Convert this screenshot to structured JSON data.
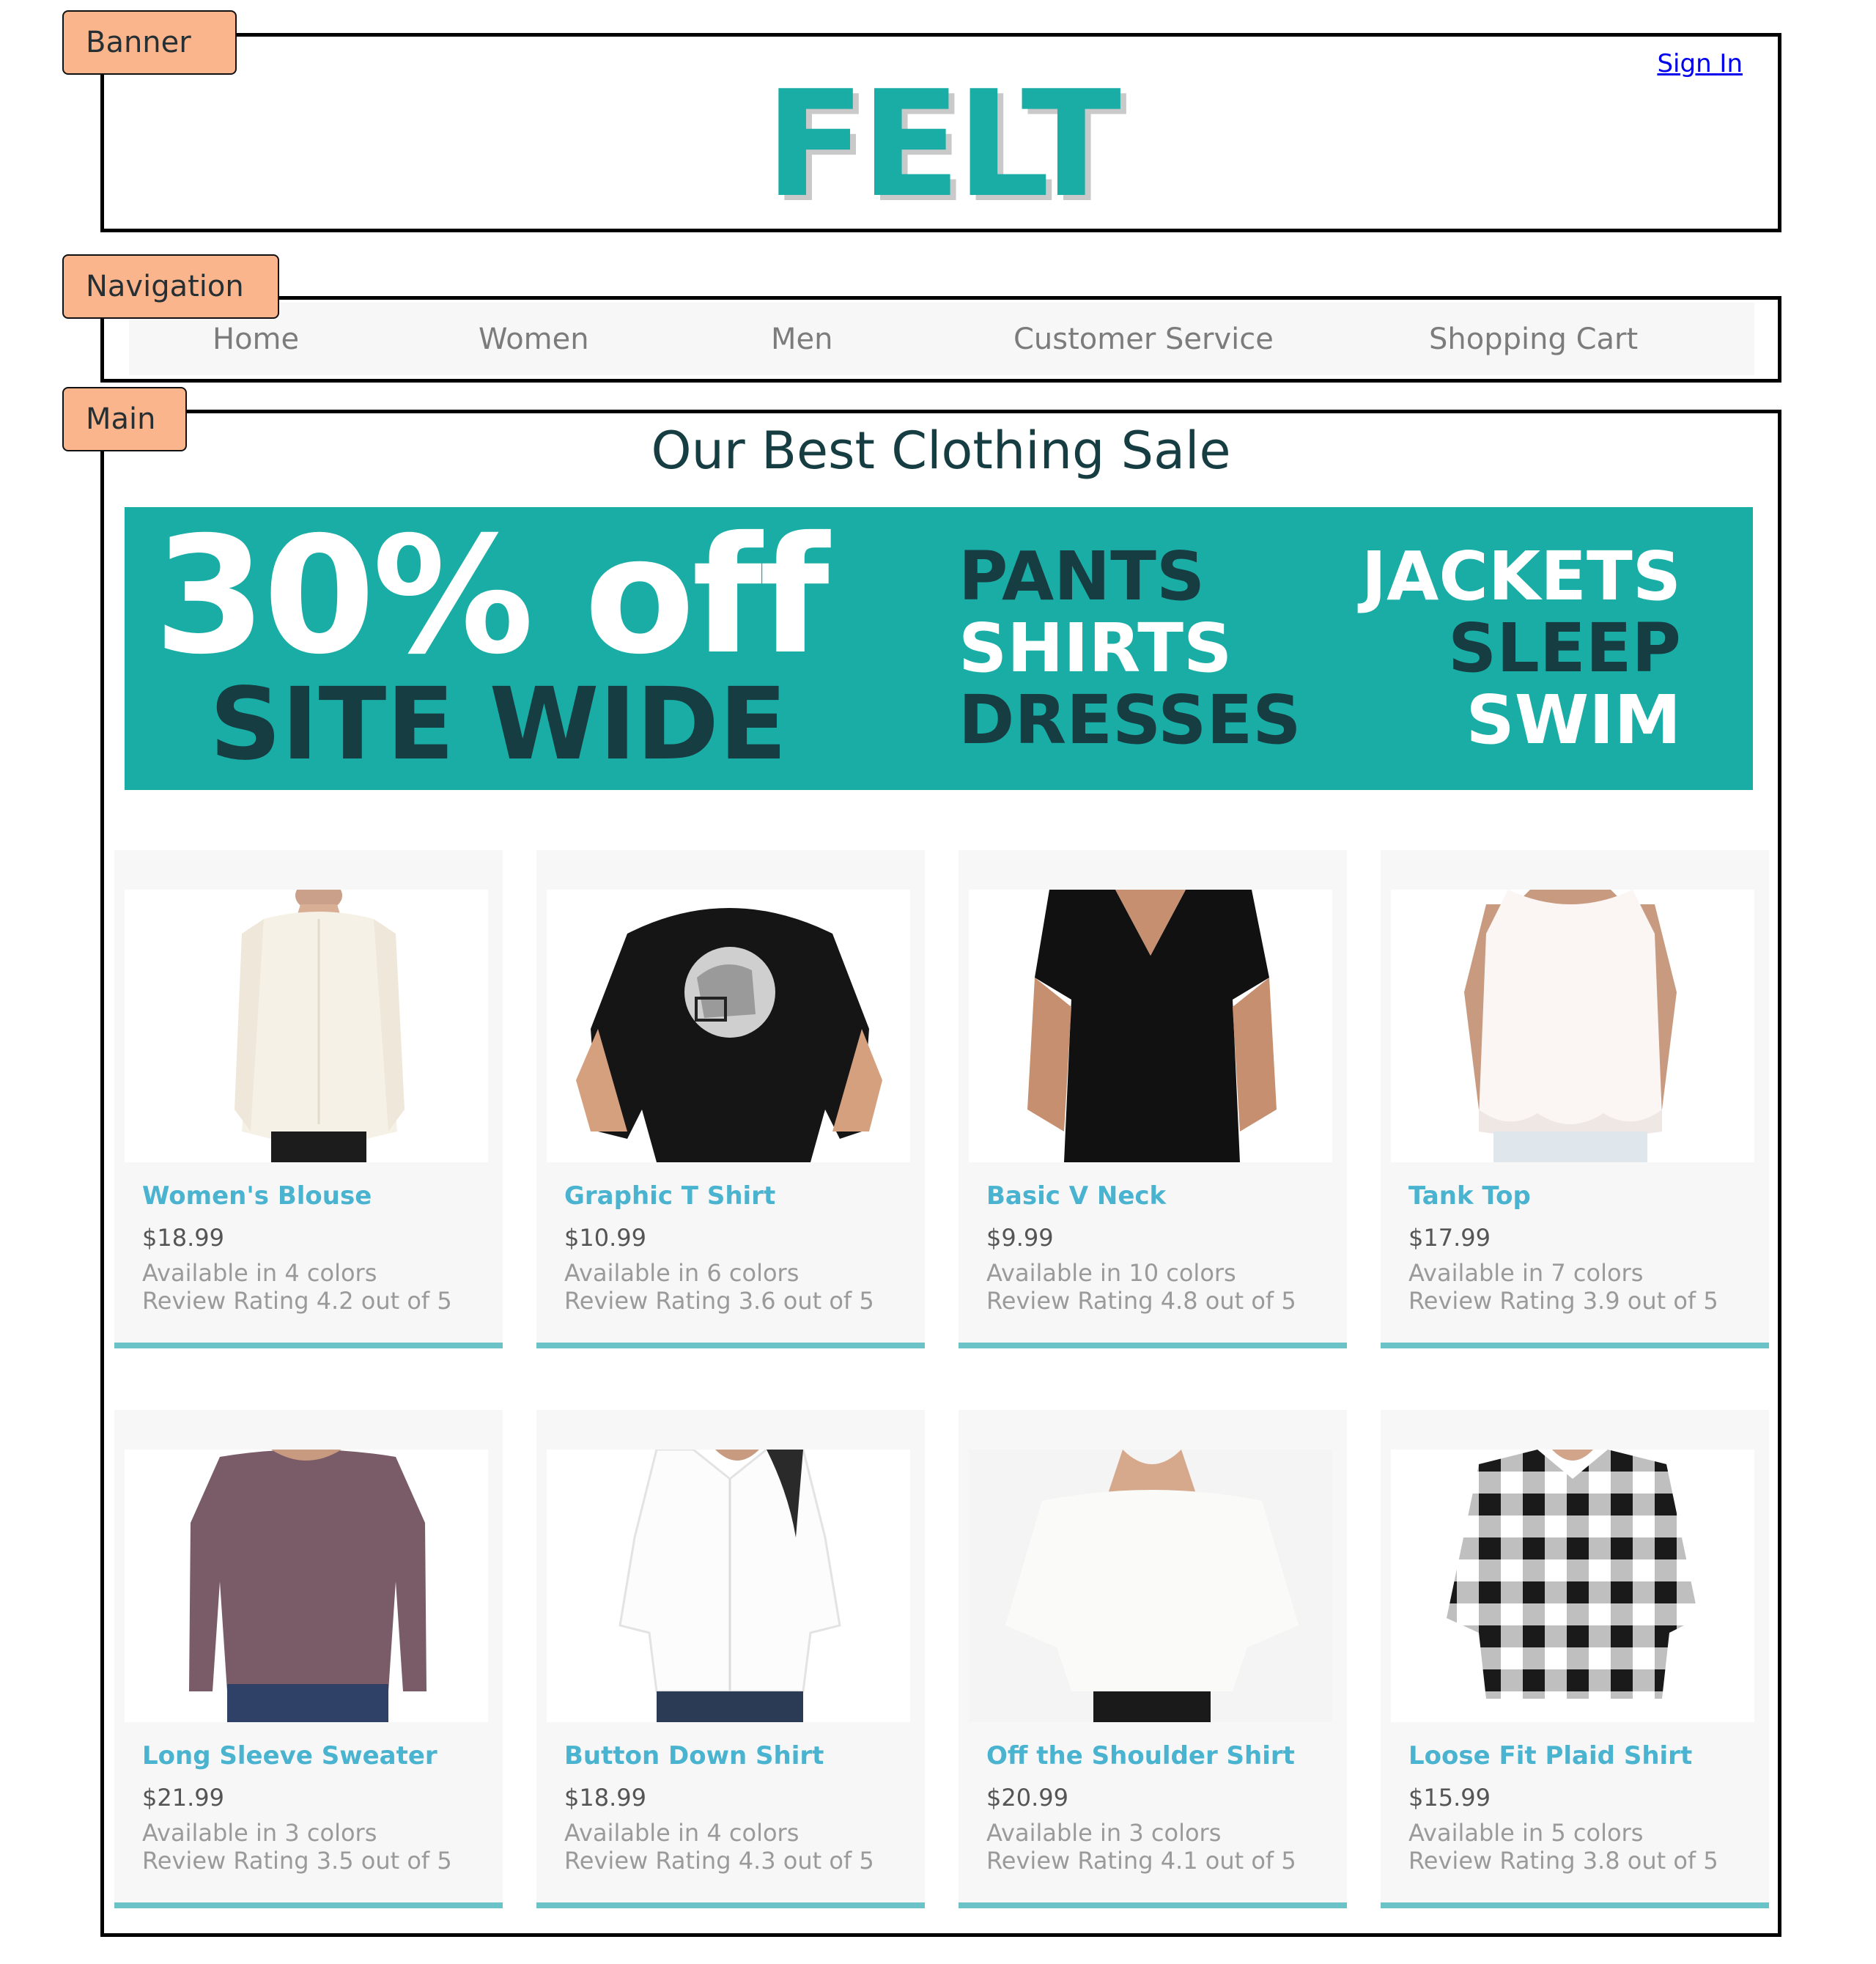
{
  "labels": {
    "banner": "Banner",
    "navigation": "Navigation",
    "main": "Main"
  },
  "header": {
    "sign_in": "Sign In",
    "logo": "FELT"
  },
  "nav": {
    "items": [
      "Home",
      "Women",
      "Men",
      "Customer Service",
      "Shopping Cart"
    ]
  },
  "main": {
    "title": "Our Best Clothing Sale",
    "promo": {
      "discount": "30% off",
      "scope": "SITE WIDE",
      "col1": [
        "PANTS",
        "SHIRTS",
        "DRESSES"
      ],
      "col2": [
        "JACKETS",
        "SLEEP",
        "SWIM"
      ]
    },
    "products": [
      {
        "name": "Women's Blouse",
        "price": "$18.99",
        "colors": "Available in 4 colors",
        "rating": "Review Rating 4.2 out of 5",
        "image": "cream-blouse"
      },
      {
        "name": "Graphic T Shirt",
        "price": "$10.99",
        "colors": "Available in 6 colors",
        "rating": "Review Rating 3.6 out of 5",
        "image": "black-tshirt-helmet"
      },
      {
        "name": "Basic V Neck",
        "price": "$9.99",
        "colors": "Available in 10 colors",
        "rating": "Review Rating 4.8 out of 5",
        "image": "black-vneck"
      },
      {
        "name": "Tank Top",
        "price": "$17.99",
        "colors": "Available in 7 colors",
        "rating": "Review Rating 3.9 out of 5",
        "image": "white-lace-tank"
      },
      {
        "name": "Long Sleeve Sweater",
        "price": "$21.99",
        "colors": "Available in 3 colors",
        "rating": "Review Rating 3.5 out of 5",
        "image": "purple-sweater"
      },
      {
        "name": "Button Down Shirt",
        "price": "$18.99",
        "colors": "Available in 4 colors",
        "rating": "Review Rating 4.3 out of 5",
        "image": "white-button-down"
      },
      {
        "name": "Off the Shoulder Shirt",
        "price": "$20.99",
        "colors": "Available in 3 colors",
        "rating": "Review Rating 4.1 out of 5",
        "image": "white-off-shoulder"
      },
      {
        "name": "Loose Fit Plaid Shirt",
        "price": "$15.99",
        "colors": "Available in 5 colors",
        "rating": "Review Rating 3.8 out of 5",
        "image": "plaid-shirt"
      }
    ]
  },
  "colors": {
    "brand": "#1aada6",
    "dark": "#163d42",
    "link": "#49b3d0",
    "accent_bar": "#6bc3c8",
    "tag": "#fbb58d"
  }
}
